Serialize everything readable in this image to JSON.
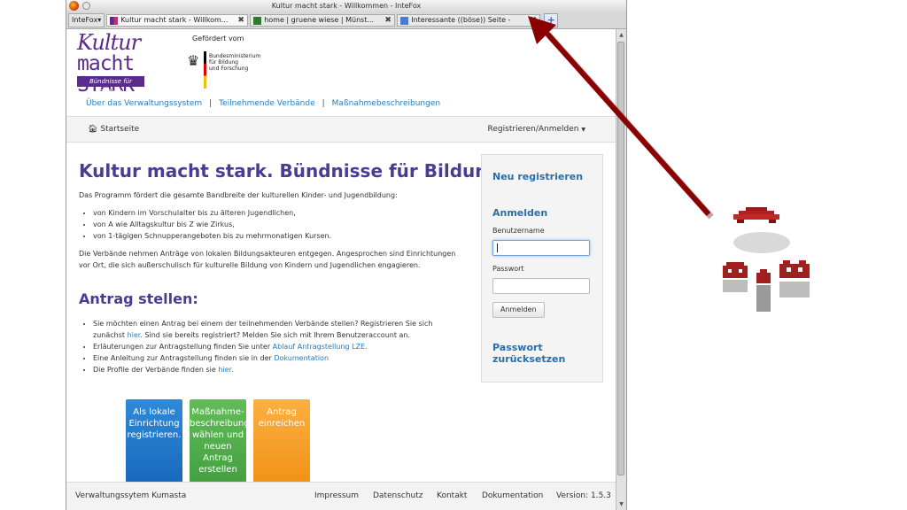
{
  "window": {
    "title": "Kultur macht stark - Willkommen - InteFox"
  },
  "browser": {
    "app_menu": "InteFox",
    "tabs": [
      {
        "title": "Kultur macht stark - Willkom...",
        "active": true
      },
      {
        "title": "home | gruene wiese | Münst...",
        "active": false
      },
      {
        "title": "Interessante ((böse)) Seite -",
        "active": false
      }
    ]
  },
  "header": {
    "logo_line1": "Kultur",
    "logo_line2": "macht STARK",
    "logo_tagline": "Bündnisse für Bildung",
    "sponsor_caption": "Gefördert vom",
    "ministry_line1": "Bundesministerium",
    "ministry_line2": "für Bildung",
    "ministry_line3": "und Forschung"
  },
  "topnav": {
    "item1": "Über das Verwaltungssystem",
    "item2": "Teilnehmende Verbände",
    "item3": "Maßnahmebeschreibungen",
    "sep": "|"
  },
  "navbar": {
    "home": "Startseite",
    "register": "Registrieren/Anmelden"
  },
  "main": {
    "title": "Kultur macht stark. Bündnisse für Bildung",
    "intro": "Das Programm fördert die gesamte Bandbreite der kulturellen Kinder- und Jugendbildung:",
    "bullets": [
      "von Kindern im Vorschulalter bis zu älteren Jugendlichen,",
      "von A wie Alltagskultur bis Z wie Zirkus,",
      "von 1-tägigen Schnupperangeboten bis zu mehrmonatigen Kursen."
    ],
    "para2": "Die Verbände nehmen Anträge von lokalen Bildungsakteuren entgegen. Angesprochen sind Einrichtungen vor Ort, die sich außerschulisch für kulturelle Bildung von Kindern und Jugendlichen engagieren.",
    "subtitle": "Antrag stellen:",
    "antrag": {
      "b1_pre": "Sie möchten einen Antrag bei einem der teilnehmenden Verbände stellen? Registrieren Sie sich zunächst",
      "b1_link": "hier",
      "b1_post": ". Sind sie bereits registriert? Melden Sie sich mit Ihrem Benutzeraccount an.",
      "b2_pre": "Erläuterungen zur Antragstellung finden Sie unter",
      "b2_link": "Ablauf Antragstellung LZE.",
      "b3_pre": "Eine Anleitung zur Antragstellung finden sie in der",
      "b3_link": "Dokumentation",
      "b4_pre": "Die Profile der Verbände finden sie",
      "b4_link": "hier",
      "b4_post": "."
    }
  },
  "sidebar": {
    "register_heading": "Neu registrieren",
    "login_heading": "Anmelden",
    "username_label": "Benutzername",
    "password_label": "Passwort",
    "login_button": "Anmelden",
    "reset_line1": "Passwort",
    "reset_line2": "zurücksetzen"
  },
  "tiles": {
    "blue_1": "Als lokale",
    "blue_2": "Einrichtung",
    "blue_3": "registrieren.",
    "green_1": "Maßnahme-",
    "green_2": "beschreibung",
    "green_3": "wählen und",
    "green_4": "neuen",
    "green_5": "Antrag",
    "green_6": "erstellen",
    "orange_1": "Antrag",
    "orange_2": "einreichen"
  },
  "footer": {
    "system": "Verwaltungssytem Kumasta",
    "impressum": "Impressum",
    "datenschutz": "Datenschutz",
    "kontakt": "Kontakt",
    "doku": "Dokumentation",
    "version": "Version: 1.5.3"
  },
  "colors": {
    "brand_purple": "#5c2a8c",
    "title_purple": "#4b3b94",
    "link_blue": "#2a7ab8",
    "arrow_red": "#8b0000"
  }
}
